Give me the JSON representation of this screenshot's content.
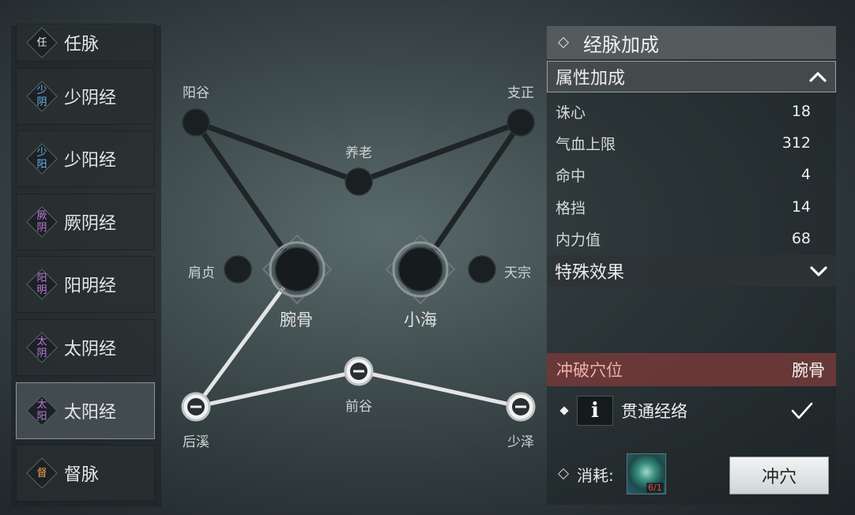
{
  "meridians": [
    {
      "name": "任脉",
      "glyph": [
        "任"
      ],
      "glyph_color": "#e8e8e8"
    },
    {
      "name": "少阴经",
      "glyph": [
        "少",
        "阴"
      ],
      "glyph_color": "#6fb6e6"
    },
    {
      "name": "少阳经",
      "glyph": [
        "少",
        "阳"
      ],
      "glyph_color": "#6fb6e6"
    },
    {
      "name": "厥阴经",
      "glyph": [
        "厥",
        "阴"
      ],
      "glyph_color": "#c07ad8"
    },
    {
      "name": "阳明经",
      "glyph": [
        "阳",
        "明"
      ],
      "glyph_color": "#c07ad8"
    },
    {
      "name": "太阴经",
      "glyph": [
        "太",
        "阴"
      ],
      "glyph_color": "#c07ad8"
    },
    {
      "name": "太阳经",
      "glyph": [
        "太",
        "阳"
      ],
      "glyph_color": "#c07ad8",
      "selected": true
    },
    {
      "name": "督脉",
      "glyph": [
        "督"
      ],
      "glyph_color": "#f0a050"
    }
  ],
  "acupoints": {
    "yanggu": "阳谷",
    "zhizheng": "支正",
    "yanglao": "养老",
    "jianzhen": "肩贞",
    "tianzong": "天宗",
    "wangu": "腕骨",
    "xiaohai": "小海",
    "qiangu": "前谷",
    "houxi": "后溪",
    "shaoze": "少泽"
  },
  "panel": {
    "title": "经脉加成",
    "attr_section": "属性加成",
    "attributes": [
      {
        "name": "诛心",
        "value": "18"
      },
      {
        "name": "气血上限",
        "value": "312"
      },
      {
        "name": "命中",
        "value": "4"
      },
      {
        "name": "格挡",
        "value": "14"
      },
      {
        "name": "内力值",
        "value": "68"
      }
    ],
    "special_section": "特殊效果",
    "break_label": "冲破穴位",
    "break_target": "腕骨",
    "requirement": "贯通经络",
    "info_glyph": "i",
    "cost_label": "消耗:",
    "cost_count": "6/1",
    "break_button": "冲穴"
  },
  "colors": {
    "active_line": "#e4e4e4",
    "inactive_line": "#1f2527",
    "break_bar": "#703a3a",
    "cost_count": "#ff3b3b"
  }
}
